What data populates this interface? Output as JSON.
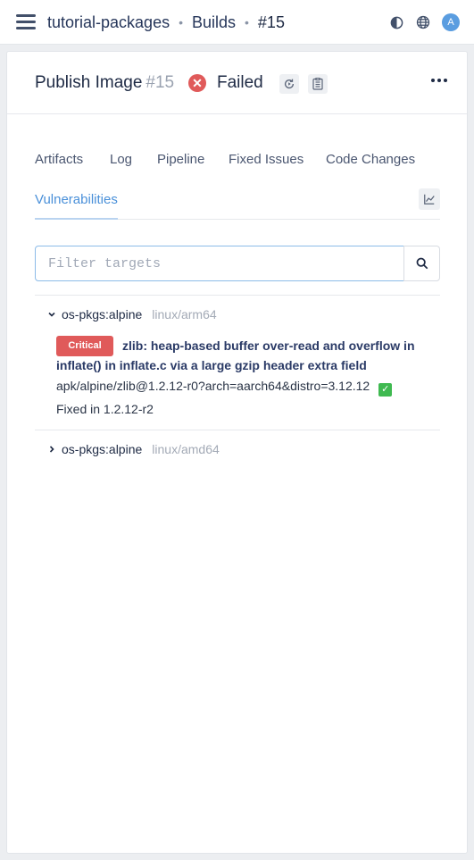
{
  "breadcrumb": {
    "repo": "tutorial-packages",
    "section": "Builds",
    "build": "#15",
    "separator": "•"
  },
  "topbar": {
    "avatar_letter": "A",
    "icons": [
      "theme-contrast-icon",
      "globe-icon"
    ]
  },
  "header": {
    "title": "Publish Image",
    "number": "#15",
    "status": "Failed",
    "status_color": "#e05a5a"
  },
  "tabs": [
    {
      "label": "Artifacts",
      "active": false
    },
    {
      "label": "Log",
      "active": false
    },
    {
      "label": "Pipeline",
      "active": false
    },
    {
      "label": "Fixed Issues",
      "active": false
    },
    {
      "label": "Code Changes",
      "active": false
    },
    {
      "label": "Vulnerabilities",
      "active": true
    }
  ],
  "filter": {
    "placeholder": "Filter targets",
    "value": ""
  },
  "targets": [
    {
      "package": "os-pkgs:alpine",
      "platform": "linux/arm64",
      "expanded": true,
      "vulnerabilities": [
        {
          "severity": "Critical",
          "title": "zlib: heap-based buffer over-read and overflow in inflate() in inflate.c via a large gzip header extra field",
          "purl": "apk/alpine/zlib@1.2.12-r0?arch=aarch64&distro=3.12.12",
          "check": "✓",
          "fixed": "Fixed in 1.2.12-r2"
        }
      ]
    },
    {
      "package": "os-pkgs:alpine",
      "platform": "linux/amd64",
      "expanded": false
    }
  ],
  "colors": {
    "accent": "#4a90d9",
    "critical": "#e05a5a",
    "ok": "#3fb950"
  }
}
